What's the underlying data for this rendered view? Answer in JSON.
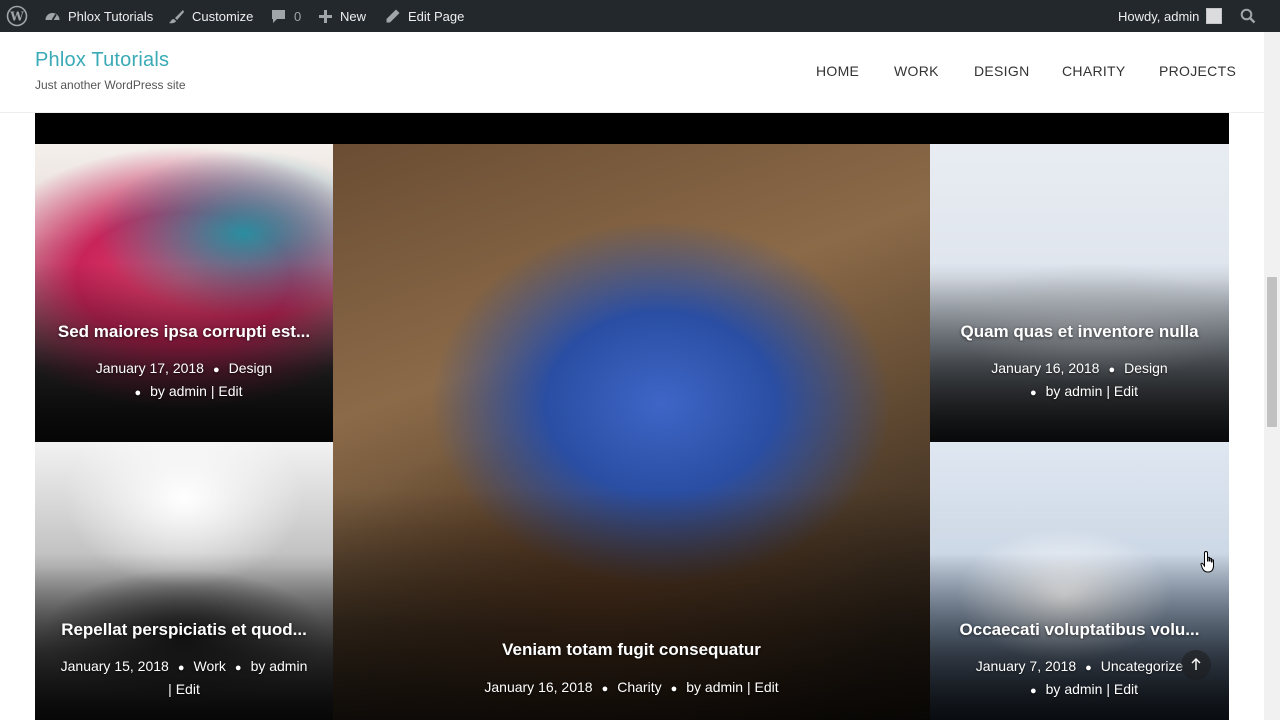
{
  "admin_bar": {
    "site_name": "Phlox Tutorials",
    "customize": "Customize",
    "comments_count": "0",
    "new": "New",
    "edit_page": "Edit Page",
    "greeting": "Howdy, admin"
  },
  "header": {
    "site_title": "Phlox Tutorials",
    "tagline": "Just another WordPress site",
    "nav": [
      "HOME",
      "WORK",
      "DESIGN",
      "CHARITY",
      "PROJECTS"
    ]
  },
  "posts": [
    {
      "title": "Sed maiores ipsa corrupti est...",
      "date": "January 17, 2018",
      "category": "Design",
      "author": "by admin",
      "edit": "Edit"
    },
    {
      "title": "Veniam totam fugit consequatur",
      "date": "January 16, 2018",
      "category": "Charity",
      "author": "by admin",
      "edit": "Edit"
    },
    {
      "title": "Quam quas et inventore nulla",
      "date": "January 16, 2018",
      "category": "Design",
      "author": "by admin",
      "edit": "Edit"
    },
    {
      "title": "Repellat perspiciatis et quod...",
      "date": "January 15, 2018",
      "category": "Work",
      "author": "by admin",
      "edit": "Edit"
    },
    {
      "title": "Occaecati voluptatibus volu...",
      "date": "January 7, 2018",
      "category": "Uncategorize",
      "author": "by admin",
      "edit": "Edit"
    }
  ],
  "icons": {
    "wp_logo": "wordpress-icon",
    "site": "dashboard-icon",
    "customize": "brush-icon",
    "comments": "comment-icon",
    "new": "plus-icon",
    "edit": "pencil-icon",
    "search": "search-icon",
    "scroll_top": "arrow-up-icon"
  },
  "colors": {
    "admin_bar_bg": "#23282d",
    "site_title": "#39aab6",
    "nav_text": "#333333"
  }
}
